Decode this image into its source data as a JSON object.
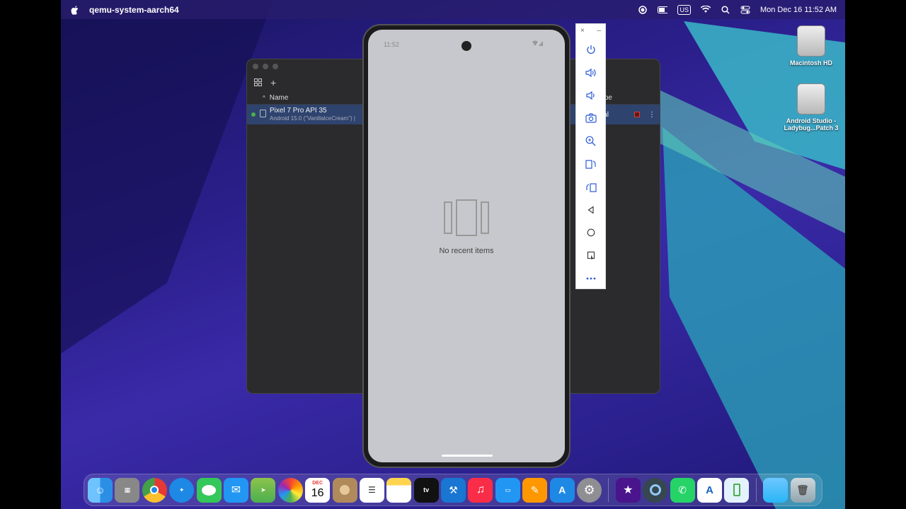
{
  "menubar": {
    "app_name": "qemu-system-aarch64",
    "input_source": "US",
    "clock": "Mon Dec 16  11:52 AM"
  },
  "desktop": {
    "icons": [
      {
        "label": "Macintosh HD"
      },
      {
        "label": "Android Studio - Ladybug...Patch 3"
      }
    ]
  },
  "studio": {
    "add_label": "+",
    "column_name": "Name",
    "column_type": "pe",
    "device": {
      "name": "Pixel 7 Pro API 35",
      "subtitle": "Android 15.0 (\"VanillaIceCream\") |",
      "type": "ual"
    }
  },
  "phone": {
    "time": "11:52",
    "empty_text": "No recent items"
  },
  "sidepanel": {
    "close": "×",
    "minimize": "–",
    "buttons": [
      "power-icon",
      "volume-up-icon",
      "volume-down-icon",
      "camera-icon",
      "zoom-icon",
      "rotate-left-icon",
      "rotate-right-icon",
      "back-icon",
      "home-icon",
      "overview-icon",
      "more-icon"
    ]
  },
  "dock": {
    "calendar_month": "DEC",
    "calendar_day": "16",
    "tv_label": "tv",
    "colors": {
      "finder": "#2b8fe6",
      "chrome": "#e53935",
      "messages": "#34c759",
      "music": "#fa2d48"
    }
  }
}
